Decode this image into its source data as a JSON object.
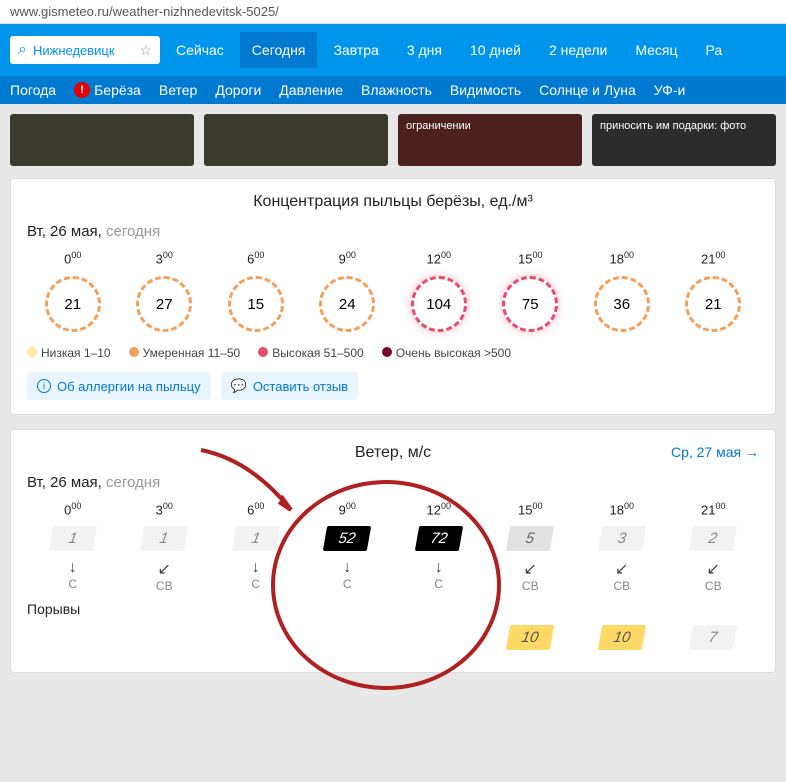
{
  "url": "www.gismeteo.ru/weather-nizhnedevitsk-5025/",
  "search": {
    "value": "Нижнедевицк"
  },
  "nav": {
    "now": "Сейчас",
    "today": "Сегодня",
    "tomorrow": "Завтра",
    "d3": "3 дня",
    "d10": "10 дней",
    "w2": "2 недели",
    "month": "Месяц",
    "ra": "Ра"
  },
  "subnav": {
    "weather": "Погода",
    "birch": "Берёза",
    "wind": "Ветер",
    "roads": "Дороги",
    "pressure": "Давление",
    "humidity": "Влажность",
    "visibility": "Видимость",
    "sun": "Солнце и Луна",
    "uvi": "УФ-и"
  },
  "promos": {
    "p3": "ограничении",
    "p4": "приносить им подарки: фото"
  },
  "pollen": {
    "title": "Концентрация пыльцы берёзы, ед./м³",
    "date_main": "Вт, 26 мая,",
    "date_gray": "сегодня",
    "times": [
      "0",
      "3",
      "6",
      "9",
      "12",
      "15",
      "18",
      "21"
    ],
    "values": [
      "21",
      "27",
      "15",
      "24",
      "104",
      "75",
      "36",
      "21"
    ],
    "levels": [
      "moderate",
      "moderate",
      "moderate",
      "moderate",
      "high",
      "high",
      "moderate",
      "moderate"
    ],
    "legend": {
      "low": "Низкая 1–10",
      "mod": "Умеренная 11–50",
      "high": "Высокая 51–500",
      "vhigh": "Очень высокая >500"
    },
    "pill1": "Об аллергии на пыльцу",
    "pill2": "Оставить отзыв"
  },
  "wind_card": {
    "title": "Ветер, м/с",
    "next": "Ср, 27 мая →",
    "date_main": "Вт, 26 мая,",
    "date_gray": "сегодня",
    "times": [
      "0",
      "3",
      "6",
      "9",
      "12",
      "15",
      "18",
      "21"
    ],
    "speeds": [
      "1",
      "1",
      "1",
      "52",
      "72",
      "5",
      "3",
      "2"
    ],
    "speed_class": [
      "low",
      "low",
      "low",
      "extreme",
      "extreme",
      "mid",
      "low",
      "low"
    ],
    "dir_arrow": [
      "↓",
      "↙",
      "↓",
      "↓",
      "↓",
      "↙",
      "↙",
      "↙"
    ],
    "dir_label": [
      "С",
      "СВ",
      "С",
      "С",
      "С",
      "СВ",
      "СВ",
      "СВ"
    ],
    "gusts_label": "Порывы",
    "gusts": [
      "",
      "",
      "",
      "",
      "",
      "10",
      "10",
      "7"
    ],
    "gust_class": [
      "",
      "",
      "",
      "",
      "",
      "gust",
      "gust",
      "low"
    ]
  },
  "colors": {
    "low": "#ffe8a3",
    "mod": "#f5a05a",
    "high": "#e84c6a",
    "vhigh": "#7a0a2a"
  }
}
